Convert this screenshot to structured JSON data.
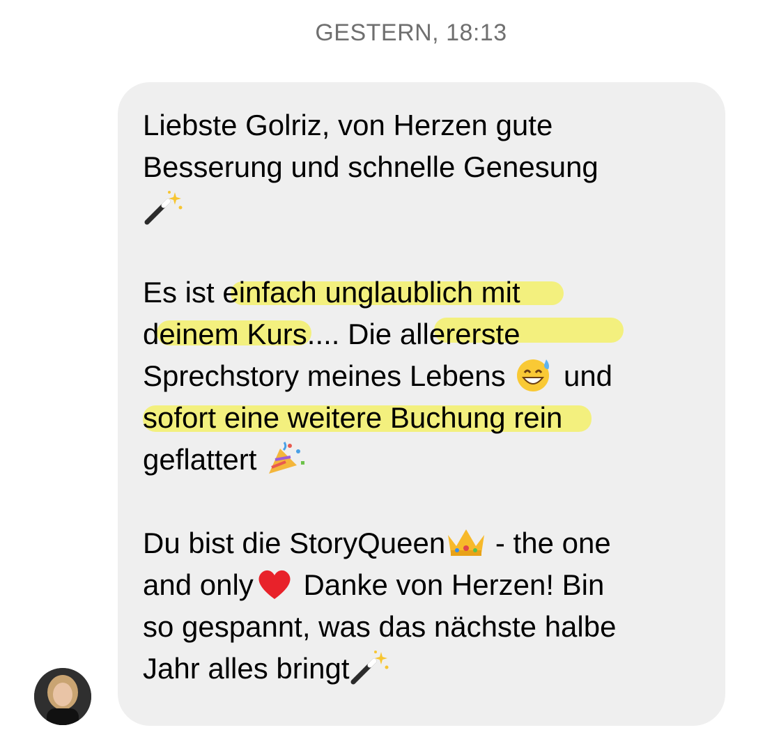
{
  "header": {
    "timestamp": "GESTERN, 18:13"
  },
  "message": {
    "lines": [
      "Liebste Golriz, von Herzen gute",
      "Besserung und schnelle Genesung",
      "",
      "",
      "Es ist einfach unglaublich mit",
      "deinem Kurs.... Die allererste",
      "Sprechstory meines Lebens",
      "und",
      "sofort eine weitere Buchung rein",
      "geflattert",
      "",
      "Du bist die StoryQueen",
      "- the one",
      "and only",
      "Danke von Herzen! Bin",
      "so gespannt, was das nächste halbe",
      "Jahr alles bringt"
    ]
  },
  "emojis": {
    "magic_wand": "magic-wand-icon",
    "grin_sweat": "grinning-sweat-icon",
    "party_popper": "party-popper-icon",
    "crown": "crown-icon",
    "heart": "red-heart-icon"
  },
  "colors": {
    "bubble": "#efefef",
    "highlight": "#f3f06a",
    "timestamp": "#6f6f6f"
  }
}
